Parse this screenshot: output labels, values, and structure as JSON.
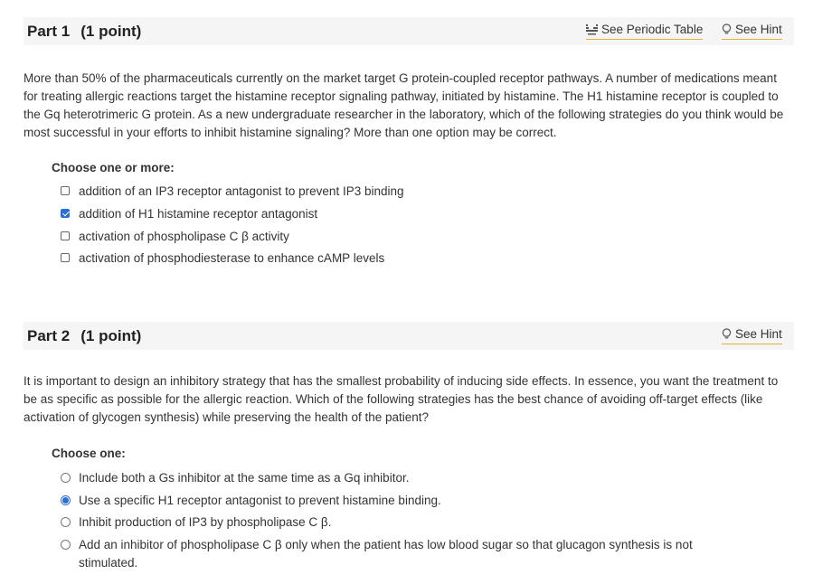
{
  "part1": {
    "title": "Part 1",
    "points": "(1 point)",
    "periodic_link": "See Periodic Table",
    "hint_link": "See Hint",
    "question": "More than 50% of the pharmaceuticals currently on the market target G protein-coupled receptor pathways. A number of medications meant for treating allergic reactions target the histamine receptor signaling pathway, initiated by histamine. The H1 histamine receptor is coupled to the Gq heterotrimeric G protein. As a new undergraduate researcher in the laboratory, which of the following strategies do you think would be most successful in your efforts to inhibit histamine signaling? More than one option may be correct.",
    "choose_label": "Choose one or more:",
    "options": [
      {
        "label": "addition of an IP3 receptor antagonist to prevent IP3 binding",
        "checked": false
      },
      {
        "label": "addition of H1 histamine receptor antagonist",
        "checked": true
      },
      {
        "label": "activation of phospholipase C β activity",
        "checked": false
      },
      {
        "label": "activation of phosphodiesterase to enhance cAMP levels",
        "checked": false
      }
    ]
  },
  "part2": {
    "title": "Part 2",
    "points": "(1 point)",
    "hint_link": "See Hint",
    "question": "It is important to design an inhibitory strategy that has the smallest probability of inducing side effects. In essence, you want the treatment to be as specific as possible for the allergic reaction. Which of the following strategies has the best chance of avoiding off-target effects (like activation of glycogen synthesis) while preserving the health of the patient?",
    "choose_label": "Choose one:",
    "options": [
      {
        "label": "Include both a Gs inhibitor at the same time as a Gq inhibitor.",
        "checked": false
      },
      {
        "label": "Use a specific H1 receptor antagonist to prevent histamine binding.",
        "checked": true
      },
      {
        "label": "Inhibit production of IP3 by phospholipase C β.",
        "checked": false
      },
      {
        "label": "Add an inhibitor of phospholipase C β only when the patient has low blood sugar so that glucagon synthesis is not stimulated.",
        "checked": false
      }
    ]
  }
}
